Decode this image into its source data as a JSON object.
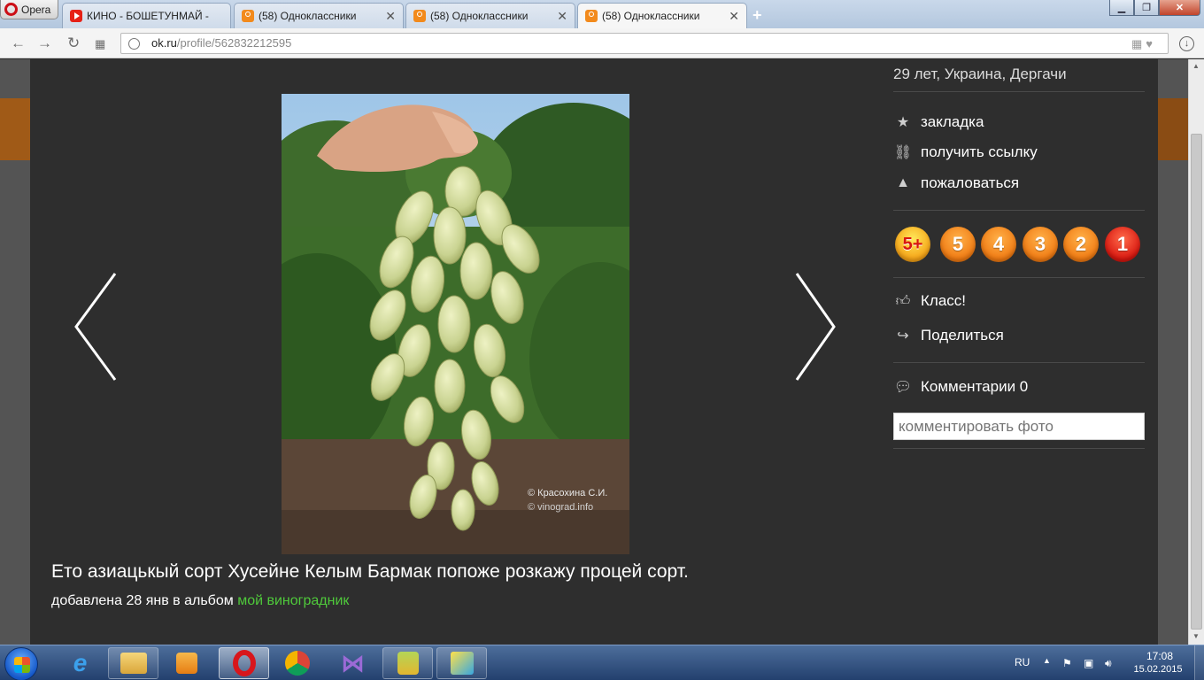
{
  "browser": {
    "menu_label": "Opera",
    "tabs": [
      {
        "label": "КИНО - БОШЕТУНМАЙ - ",
        "favicon": "youtube-icon"
      },
      {
        "label": "(58) Одноклассники",
        "favicon": "odnoklassniki-icon"
      },
      {
        "label": "(58) Одноклассники",
        "favicon": "odnoklassniki-icon"
      },
      {
        "label": "(58) Одноклассники",
        "favicon": "odnoklassniki-icon",
        "active": true
      }
    ],
    "new_tab": "+",
    "url_host": "ok.ru",
    "url_path": "/profile/562832212595"
  },
  "viewer": {
    "watermark_author": "© Красохина С.И.",
    "watermark_site": "© vinograd.info",
    "caption": "Ето азиацькый сорт Хусейне Келым Бармак попоже розкажу процей сорт.",
    "added_prefix": "добавлена 28 янв в альбом ",
    "album_name": "мой виноградник"
  },
  "side": {
    "author_info": "29 лет, Украина, Дергачи",
    "actions": {
      "bookmark": "закладка",
      "get_link": "получить ссылку",
      "report": "пожаловаться"
    },
    "ratings": [
      "5+",
      "5",
      "4",
      "3",
      "2",
      "1"
    ],
    "like": "Класс!",
    "share": "Поделиться",
    "comments": "Комментарии 0",
    "comment_placeholder": "комментировать фото"
  },
  "taskbar": {
    "lang": "RU",
    "time": "17:08",
    "date": "15.02.2015"
  },
  "colors": {
    "album_link": "#4fc93b",
    "viewer_bg": "#2e2e2e",
    "rating_orange": "#f07a12",
    "rating_red": "#d8170f"
  }
}
